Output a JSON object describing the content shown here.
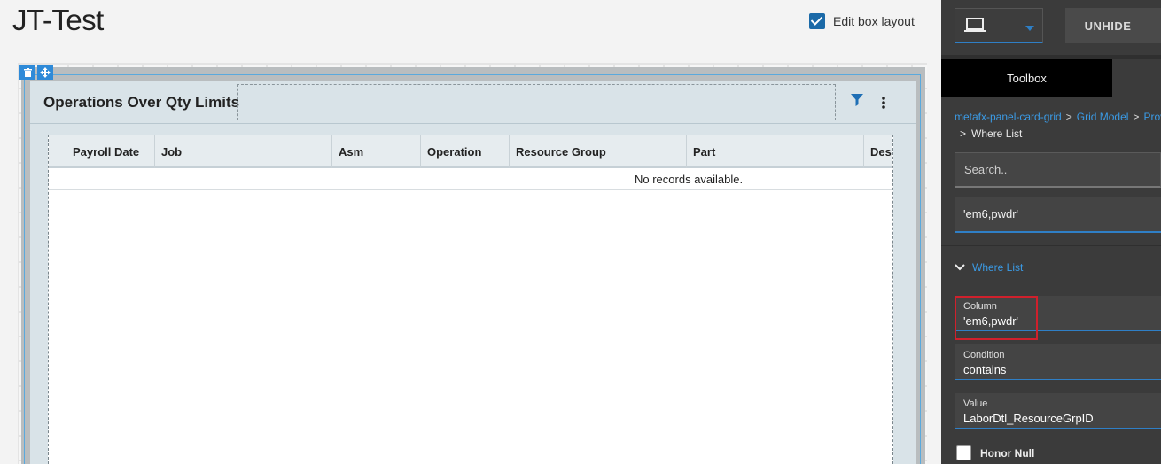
{
  "page": {
    "title": "JT-Test"
  },
  "edit_toggle": {
    "label": "Edit box layout",
    "checked": true
  },
  "card": {
    "title": "Operations Over Qty Limits",
    "columns": [
      "Payroll Date",
      "Job",
      "Asm",
      "Operation",
      "Resource Group",
      "Part",
      "Desc"
    ],
    "empty_text": "No records available."
  },
  "panel": {
    "unhide_label": "UNHIDE",
    "toolbox_tab": "Toolbox",
    "breadcrumbs": [
      "metafx-panel-card-grid",
      "Grid Model",
      "Provi"
    ],
    "breadcrumb_sep": ">",
    "breadcrumb_current": "Where List",
    "search_placeholder": "Search..",
    "selected_value": "'em6,pwdr'",
    "section_title": "Where List",
    "fields": {
      "column": {
        "label": "Column",
        "value": "'em6,pwdr'"
      },
      "condition": {
        "label": "Condition",
        "value": "contains"
      },
      "value": {
        "label": "Value",
        "value": "LaborDtl_ResourceGrpID"
      }
    },
    "honor_null_label": "Honor Null",
    "honor_null_checked": false
  },
  "colors": {
    "accent": "#2f7fc6",
    "link": "#3b9be6",
    "highlight": "#d0202c",
    "checkbox": "#1b6aa8"
  }
}
